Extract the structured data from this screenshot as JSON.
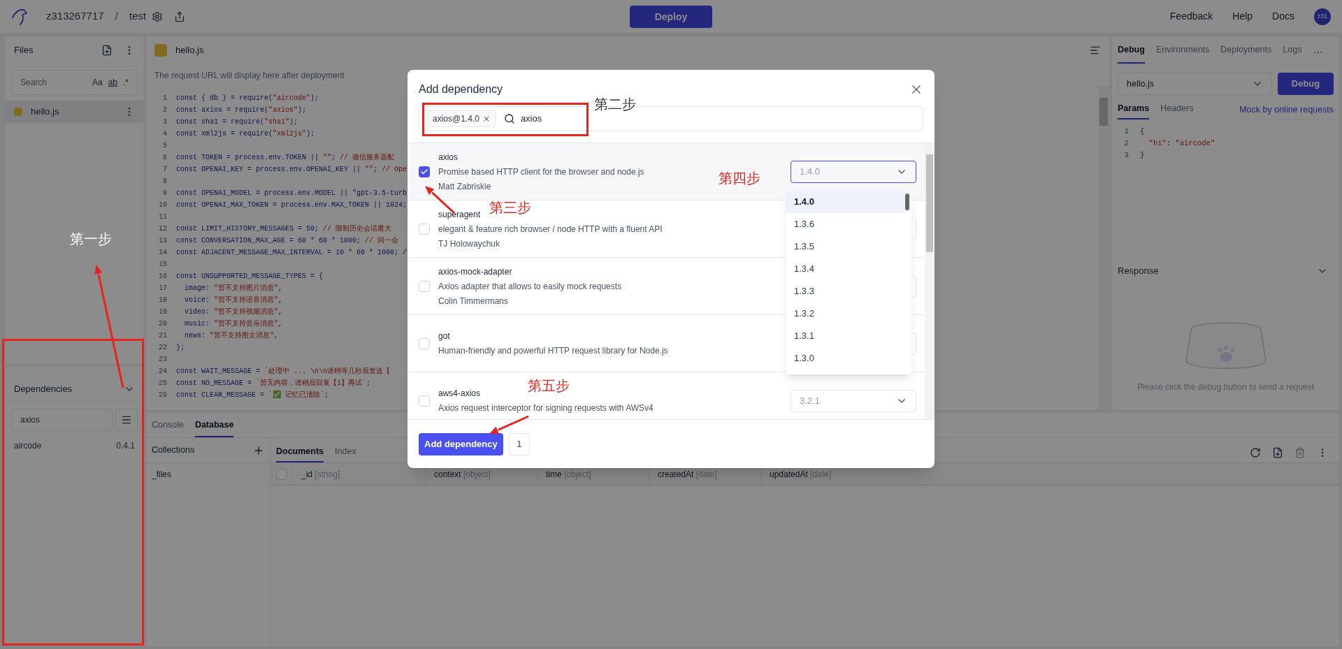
{
  "top_bar": {
    "user": "z313267717",
    "separator": "/",
    "project": "test",
    "deploy_button": "Deploy",
    "links": [
      "Feedback",
      "Help",
      "Docs"
    ],
    "avatar": "z31"
  },
  "files_panel": {
    "title": "Files",
    "search_placeholder": "Search",
    "search_options": [
      "Aa",
      "ab",
      ".*"
    ],
    "files": [
      {
        "name": "hello.js",
        "selected": true
      }
    ]
  },
  "dependencies_panel": {
    "title": "Dependencies",
    "search_value": "axios",
    "packages": [
      {
        "name": "aircode",
        "version": "0.4.1"
      }
    ]
  },
  "editor": {
    "tab": "hello.js",
    "url_hint": "The request URL will display here after deployment",
    "lines": [
      {
        "number": "1",
        "code": "const { db } = require(\"aircode\");"
      },
      {
        "number": "2",
        "code": "const axios = require(\"axios\");"
      },
      {
        "number": "3",
        "code": "const sha1 = require(\"sha1\");"
      },
      {
        "number": "4",
        "code": "const xml2js = require(\"xml2js\");"
      },
      {
        "number": "5"
      },
      {
        "number": "6",
        "code": "const TOKEN = process.env.TOKEN || \"\"; // 微信服务器配"
      },
      {
        "number": "7",
        "code": "const OPENAI_KEY = process.env.OPENAI_KEY || \"\"; // Ope"
      },
      {
        "number": "8"
      },
      {
        "number": "9",
        "code": "const OPENAI_MODEL = process.env.MODEL || \"gpt-3.5-turb"
      },
      {
        "number": "10",
        "code": "const OPENAI_MAX_TOKEN = process.env.MAX_TOKEN || 1024;"
      },
      {
        "number": "11"
      },
      {
        "number": "12",
        "code": "const LIMIT_HISTORY_MESSAGES = 50; // 限制历史会话最大"
      },
      {
        "number": "13",
        "code": "const CONVERSATION_MAX_AGE = 60 * 60 * 1000; // 同一会"
      },
      {
        "number": "14",
        "code": "const ADJACENT_MESSAGE_MAX_INTERVAL = 10 * 60 * 1000; /"
      },
      {
        "number": "15"
      },
      {
        "number": "16",
        "code": "const UNSUPPORTED_MESSAGE_TYPES = {"
      },
      {
        "number": "17",
        "code": "  image: \"暂不支持图片消息\","
      },
      {
        "number": "18",
        "code": "  voice: \"暂不支持语音消息\","
      },
      {
        "number": "19",
        "code": "  video: \"暂不支持视频消息\","
      },
      {
        "number": "20",
        "code": "  music: \"暂不支持音乐消息\","
      },
      {
        "number": "21",
        "code": "  news: \"暂不支持图文消息\","
      },
      {
        "number": "22",
        "code": "};"
      },
      {
        "number": "23"
      },
      {
        "number": "24",
        "code": "const WAIT_MESSAGE = `处理中 ... \\n\\n请稍等几秒后发送【"
      },
      {
        "number": "25",
        "code": "const NO_MESSAGE = `暂无内容，请稍后回复【1】再试`;"
      },
      {
        "number": "26",
        "code": "const CLEAR_MESSAGE = `✅ 记忆已清除`;"
      }
    ]
  },
  "debug_panel": {
    "tabs": [
      {
        "label": "Debug",
        "selected": true
      },
      {
        "label": "Environments",
        "selected": false
      },
      {
        "label": "Deployments",
        "selected": false
      },
      {
        "label": "Logs",
        "selected": false
      }
    ],
    "file_select": "hello.js",
    "debug_button": "Debug",
    "sub_tabs": [
      {
        "label": "Params",
        "selected": true
      },
      {
        "label": "Headers",
        "selected": false
      }
    ],
    "mock_link": "Mock by online requests",
    "params_lines": [
      {
        "number": "1",
        "code": "{"
      },
      {
        "number": "2",
        "code": "  \"hi\": \"aircode\""
      },
      {
        "number": "3",
        "code": "}"
      }
    ],
    "response_title": "Response",
    "response_empty": "Please click the debug button to send a request"
  },
  "bottom_panel": {
    "tabs": [
      {
        "label": "Console",
        "selected": false
      },
      {
        "label": "Database",
        "selected": true
      }
    ],
    "collections_title": "Collections",
    "collections": [
      {
        "name": "_files",
        "selected": false
      }
    ],
    "select_all_checked": false,
    "doc_tabs": [
      {
        "label": "Documents",
        "selected": true
      },
      {
        "label": "Index",
        "selected": false
      }
    ],
    "columns": [
      {
        "name": "_id",
        "type": "[string]"
      },
      {
        "name": "context",
        "type": "[object]"
      },
      {
        "name": "time",
        "type": "[object]"
      },
      {
        "name": "createdAt",
        "type": "[date]"
      },
      {
        "name": "updatedAt",
        "type": "[date]"
      }
    ]
  },
  "dialog": {
    "title": "Add dependency",
    "chips": [
      "axios@1.4.0"
    ],
    "search_value": "axios",
    "results": [
      {
        "name": "axios",
        "description": "Promise based HTTP client for the browser and node.js",
        "author": "Matt Zabriskie",
        "checked": true,
        "version": "1.4.0",
        "expanded": true,
        "options": [
          {
            "label": "1.4.0",
            "selected": true
          },
          {
            "label": "1.3.6",
            "selected": false
          },
          {
            "label": "1.3.5",
            "selected": false
          },
          {
            "label": "1.3.4",
            "selected": false
          },
          {
            "label": "1.3.3",
            "selected": false
          },
          {
            "label": "1.3.2",
            "selected": false
          },
          {
            "label": "1.3.1",
            "selected": false
          },
          {
            "label": "1.3.0",
            "selected": false
          }
        ]
      },
      {
        "name": "superagent",
        "description": "elegant & feature rich browser / node HTTP with a fluent API",
        "author": "TJ Holowaychuk",
        "checked": false,
        "expanded": false
      },
      {
        "name": "axios-mock-adapter",
        "description": "Axios adapter that allows to easily mock requests",
        "author": "Colin Timmermans",
        "checked": false,
        "expanded": false
      },
      {
        "name": "got",
        "description": "Human-friendly and powerful HTTP request library for Node.js",
        "checked": false,
        "expanded": false
      },
      {
        "name": "aws4-axios",
        "description": "Axios request interceptor for signing requests with AWSv4",
        "checked": false,
        "version": "3.2.1",
        "expanded": false
      }
    ],
    "add_button": "Add dependency",
    "count": "1"
  },
  "annotations": [
    {
      "label": "第一步",
      "color": "#ffffff"
    },
    {
      "label": "第二步",
      "color": "#333333"
    },
    {
      "label": "第三步",
      "color": "#e8231b"
    },
    {
      "label": "第四步",
      "color": "#e8231b"
    },
    {
      "label": "第五步",
      "color": "#e8231b"
    }
  ]
}
